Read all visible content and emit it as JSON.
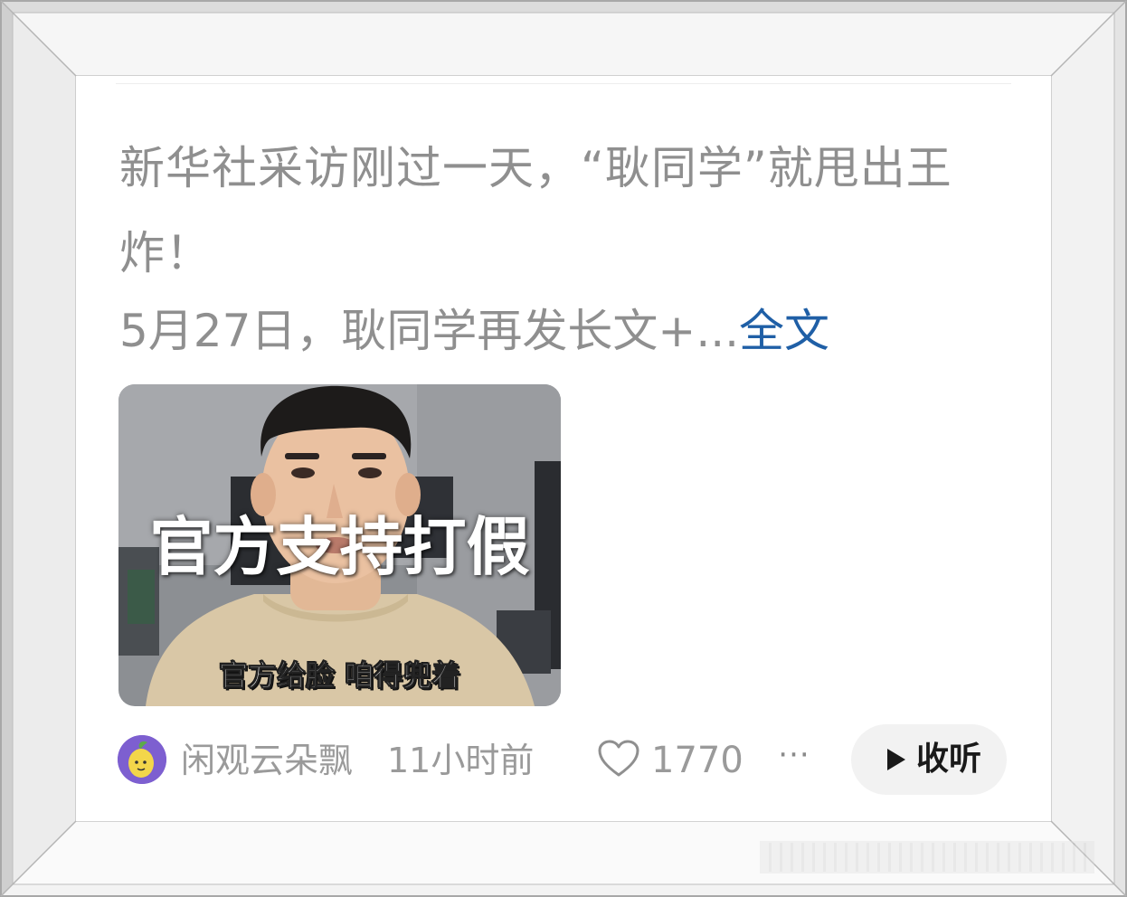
{
  "post": {
    "title": "新华社采访刚过一天，“耿同学”就甩出王炸！",
    "summary": "5月27日，耿同学再发长文+...",
    "fulltext_link": "全文",
    "thumbnail": {
      "caption": "官方支持打假",
      "subtitle": "官方给脸 咱得兜着"
    },
    "author": "闲观云朵飘",
    "time": "11小时前",
    "likes": "1770",
    "more_label": "···",
    "listen_label": "收听"
  },
  "icons": {
    "like": "heart-icon",
    "more": "more-icon",
    "play": "play-icon"
  },
  "colors": {
    "text_gray": "#8f8f8f",
    "link_blue": "#1f5fa6",
    "listen_bg": "#f2f2f2",
    "avatar_bg": "#7d5fd0"
  }
}
